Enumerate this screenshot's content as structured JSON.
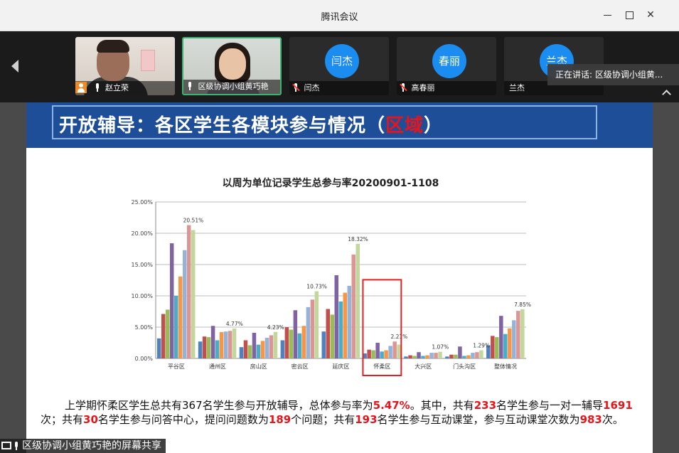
{
  "window": {
    "title": "腾讯会议"
  },
  "participants": [
    {
      "name": "赵立荣",
      "muted": false,
      "type": "video",
      "is_host": true
    },
    {
      "name": "区级协调小组黄巧艳",
      "muted": false,
      "type": "video",
      "active": true
    },
    {
      "name": "闫杰",
      "avatar_text": "闫杰",
      "muted": true,
      "type": "avatar"
    },
    {
      "name": "高春丽",
      "avatar_text": "春丽",
      "muted": true,
      "type": "avatar"
    },
    {
      "name": "兰杰",
      "avatar_text": "兰杰",
      "muted": false,
      "type": "avatar"
    }
  ],
  "speaking": "正在讲话: 区级协调小组黄...",
  "slide": {
    "title_prefix": "开放辅导：各区学生各模块参与情况（",
    "title_highlight": "区域",
    "title_suffix": "）",
    "paragraph": [
      {
        "t": "上学期怀柔区学生总共有367名学生参与开放辅导，总体参与率为"
      },
      {
        "t": "5.47%",
        "r": true
      },
      {
        "t": "。其中，共有"
      },
      {
        "t": "233",
        "r": true
      },
      {
        "t": "名学生参与一对一辅导"
      },
      {
        "t": "1691",
        "r": true
      },
      {
        "t": "次；共有"
      },
      {
        "t": "30",
        "r": true
      },
      {
        "t": "名学生参与问答中心，提问问题数为"
      },
      {
        "t": "189",
        "r": true
      },
      {
        "t": "个问题；共有"
      },
      {
        "t": "193",
        "r": true
      },
      {
        "t": "名学生参与互动课堂，参与互动课堂次数为"
      },
      {
        "t": "983",
        "r": true
      },
      {
        "t": "次。"
      }
    ]
  },
  "share_label": "区级协调小组黄巧艳的屏幕共享",
  "chart_data": {
    "type": "bar",
    "title": "以周为单位记录学生总参与率20200901-1108",
    "categories": [
      "平谷区",
      "通州区",
      "房山区",
      "密云区",
      "延庆区",
      "怀柔区",
      "大兴区",
      "门头沟区",
      "整体情况"
    ],
    "ylim": [
      0,
      25
    ],
    "yticks": [
      "0.00%",
      "5.00%",
      "10.00%",
      "15.00%",
      "20.00%",
      "25.00%"
    ],
    "grid": true,
    "highlight_category": "怀柔区",
    "highlight_color": "#e52020",
    "series_colors": [
      "#4f81bd",
      "#c0504d",
      "#9bbb59",
      "#8064a2",
      "#4bacc6",
      "#f79646",
      "#95b3d7",
      "#d99694",
      "#c3d69b"
    ],
    "series": [
      {
        "values": [
          3.2,
          2.7,
          1.8,
          2.9,
          4.3,
          0.8,
          0.3,
          0.3,
          2.1
        ]
      },
      {
        "values": [
          7.1,
          3.5,
          2.9,
          5.0,
          7.9,
          1.4,
          0.5,
          0.6,
          3.6
        ]
      },
      {
        "values": [
          7.8,
          3.4,
          2.1,
          4.6,
          7.0,
          1.3,
          0.4,
          0.6,
          3.4
        ]
      },
      {
        "values": [
          18.4,
          5.2,
          4.1,
          7.7,
          13.3,
          2.5,
          1.0,
          1.9,
          6.8
        ]
      },
      {
        "values": [
          10.0,
          2.9,
          2.2,
          4.0,
          9.1,
          1.1,
          0.4,
          0.4,
          3.9
        ]
      },
      {
        "values": [
          13.1,
          4.2,
          2.8,
          5.2,
          10.5,
          1.3,
          0.5,
          0.5,
          4.8
        ]
      },
      {
        "values": [
          17.3,
          4.3,
          3.3,
          8.2,
          11.6,
          2.0,
          0.9,
          0.9,
          6.1
        ]
      },
      {
        "values": [
          21.3,
          4.4,
          3.7,
          9.4,
          16.6,
          2.7,
          0.9,
          1.0,
          7.6
        ]
      },
      {
        "values": [
          20.51,
          4.77,
          4.23,
          10.73,
          18.32,
          2.21,
          1.07,
          1.29,
          7.85
        ]
      }
    ],
    "data_labels": [
      "20.51%",
      "4.77%",
      "4.23%",
      "10.73%",
      "18.32%",
      "2.21%",
      "1.07%",
      "1.29%",
      "7.85%"
    ]
  }
}
